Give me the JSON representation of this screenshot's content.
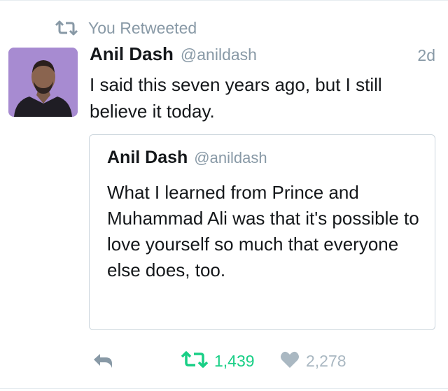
{
  "retweet_context": {
    "label": "You Retweeted"
  },
  "tweet": {
    "author_name": "Anil Dash",
    "author_handle": "@anildash",
    "timestamp": "2d",
    "text": "I said this seven years ago, but I still believe it today."
  },
  "quoted_tweet": {
    "author_name": "Anil Dash",
    "author_handle": "@anildash",
    "text": "What I learned from Prince and Muhammad Ali was that it's possible to love yourself so much that everyone else does, too."
  },
  "actions": {
    "retweet_count": "1,439",
    "like_count": "2,278"
  },
  "colors": {
    "retweeted_green": "#19cf86",
    "muted_gray": "#8899a6",
    "like_gray": "#aab8c2",
    "avatar_bg": "#a78bd1"
  },
  "icons": {
    "retweet": "retweet-icon",
    "reply": "reply-icon",
    "like": "heart-icon"
  }
}
